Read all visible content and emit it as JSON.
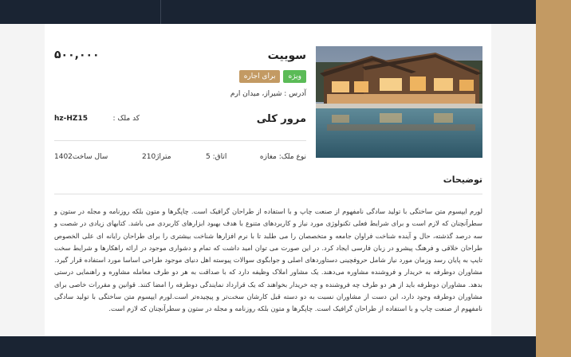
{
  "property": {
    "title": "سوییت",
    "price": "۵۰۰,۰۰۰",
    "badges": {
      "special": "ویژه",
      "rent": "برای اجاره"
    },
    "address": "آدرس : شیراز، میدان ارم"
  },
  "overview": {
    "heading": "مرور کلی",
    "code_label": "کد ملک :",
    "code_value": "hz-HZ15",
    "type": "نوع ملک: مغازه",
    "rooms": "اتاق: 5",
    "area": "متراژ210",
    "year": "سال ساخت1402"
  },
  "description": {
    "heading": "توضیحات",
    "text": "لورم ایپسوم متن ساختگی با تولید سادگی نامفهوم از صنعت چاپ و با استفاده از طراحان گرافیک است. چاپگرها و متون بلکه روزنامه و مجله در ستون و سطرآنچنان که لازم است و برای شرایط فعلی تکنولوژی مورد نیاز و کاربردهای متنوع با هدف بهبود ابزارهای کاربردی می باشد. کتابهای زیادی در شصت و سه درصد گذشته، حال و آینده شناخت فراوان جامعه و متخصصان را می طلبد تا با نرم افزارها شناخت بیشتری را برای طراحان رایانه ای علی الخصوص طراحان خلاقی و فرهنگ پیشرو در زبان فارسی ایجاد کرد. در این صورت می توان امید داشت که تمام و دشواری موجود در ارائه راهکارها و شرایط سخت تایپ به پایان رسد وزمان مورد نیاز شامل حروفچینی دستاوردهای اصلی و جوابگوی سوالات پیوسته اهل دنیای موجود طراحی اساسا مورد استفاده قرار گیرد. مشاوران دوطرفه به خریدار و فروشنده مشاوره می‌دهند. یک مشاور املاک وظیفه دارد که با صداقت به هر دو طرف معامله مشاوره و راهنمایی درستی بدهد. مشاوران دوطرفه باید از هر دو طرف چه فروشنده و چه خریدار بخواهند که یک قرارداد نمایندگی دوطرفه را امضا کنند. قوانین و مقررات خاصی برای مشاوران دوطرفه وجود دارد، این دست از مشاوران نسبت به دو دسته قبل کارشان سخت‌تر و پیچیده‌تر است.لورم ایپسوم متن ساختگی با تولید سادگی نامفهوم از صنعت چاپ و با استفاده از طراحان گرافیک است. چاپگرها و متون بلکه روزنامه و مجله در ستون و سطرآنچنان که لازم است."
  },
  "image": {
    "subject": "house-with-pool-photo"
  },
  "colors": {
    "navy": "#1a2433",
    "gold": "#c39a63",
    "green": "#5bbb57"
  }
}
